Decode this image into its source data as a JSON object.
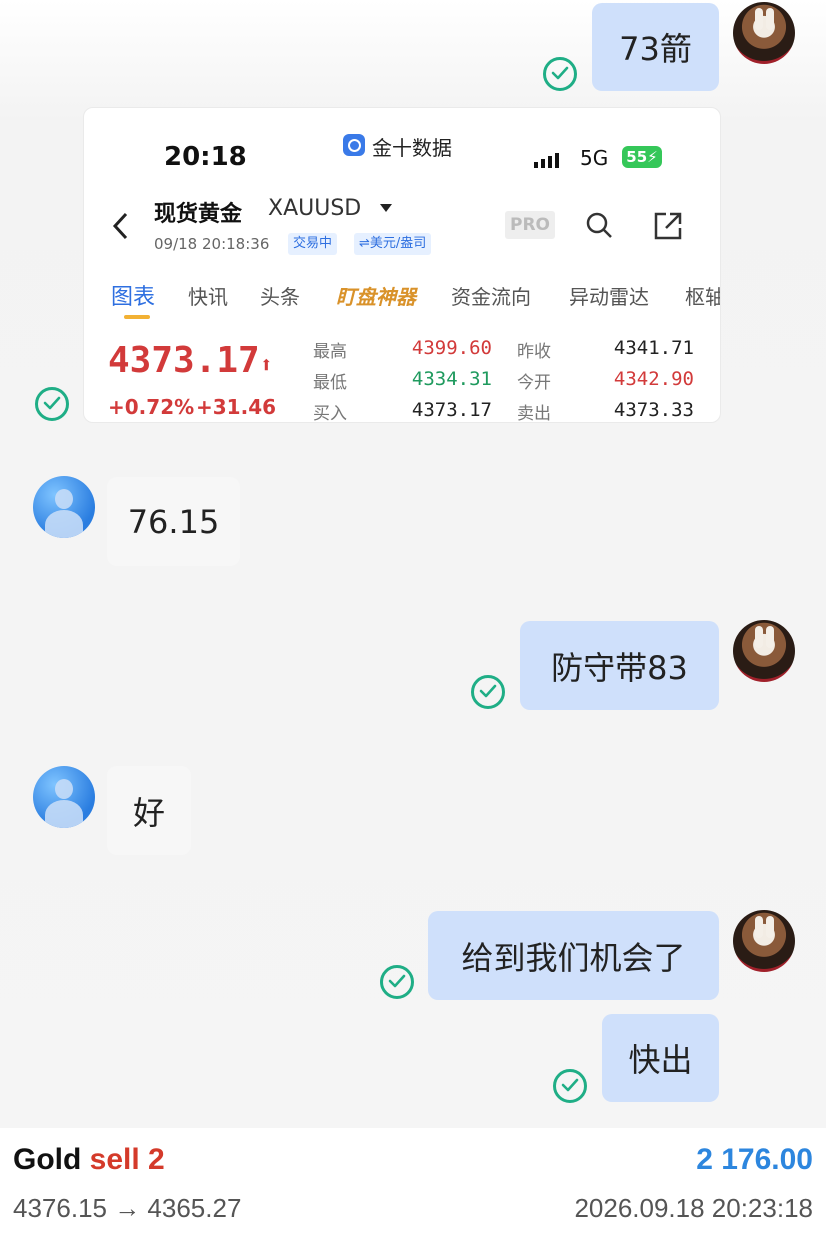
{
  "messages": {
    "m1": "73箭",
    "m2": "76.15",
    "m3": "防守带83",
    "m4": "好",
    "m5": "给到我们机会了",
    "m6": "快出"
  },
  "screenshot": {
    "time": "20:18",
    "app_name": "金十数据",
    "network": "5G",
    "battery": "55",
    "instrument_name": "现货黄金",
    "symbol": "XAUUSD",
    "datetime": "09/18 20:18:36",
    "status_tag": "交易中",
    "currency_tag": "⇌美元/盎司",
    "pro_label": "PRO",
    "tabs": [
      "图表",
      "快讯",
      "头条",
      "盯盘神器",
      "资金流向",
      "异动雷达",
      "枢轴"
    ],
    "price": "4373.17",
    "change_pct": "+0.72%",
    "change_abs": "+31.46",
    "quotes": {
      "high_label": "最高",
      "high": "4399.60",
      "low_label": "最低",
      "low": "4334.31",
      "buy_label": "买入",
      "buy": "4373.17",
      "prev_close_label": "昨收",
      "prev_close": "4341.71",
      "open_label": "今开",
      "open": "4342.90",
      "sell_label": "卖出",
      "sell": "4373.33"
    }
  },
  "footer": {
    "title_prefix": "Gold",
    "title_action": "sell 2",
    "amount": "2 176.00",
    "price_range": "4376.15 → 4365.27",
    "timestamp": "2026.09.18 20:23:18"
  },
  "colors": {
    "outgoing_bubble": "#cfe0fb",
    "incoming_bubble": "#f7f7f7",
    "check_green": "#1fae86",
    "price_red": "#d23a3a",
    "price_green": "#1f9a5e",
    "amount_blue": "#2d86de",
    "sell_red": "#d43a2a"
  }
}
